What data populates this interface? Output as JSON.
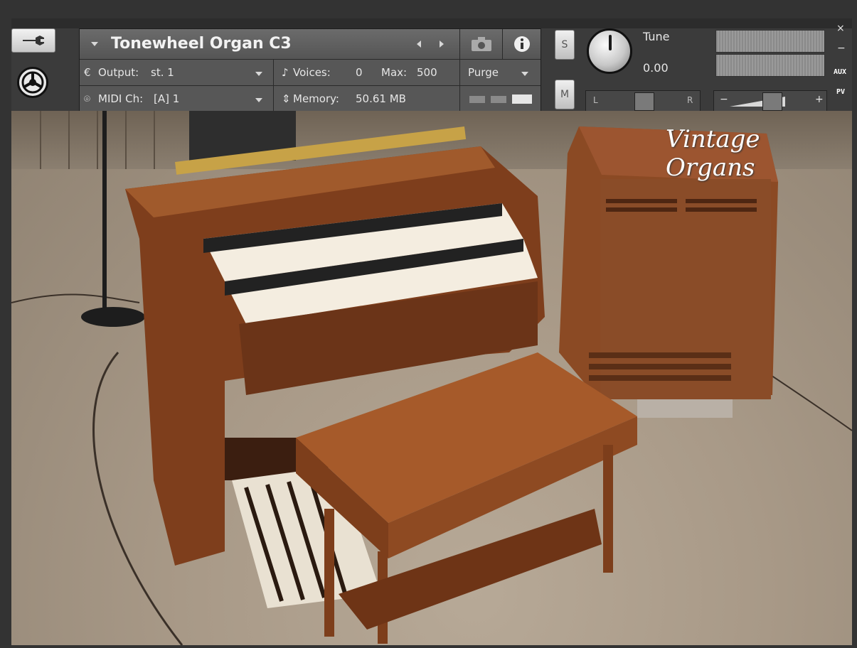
{
  "instrument": {
    "title": "Tonewheel Organ C3",
    "output_label": "Output:",
    "output_value": "st. 1",
    "voices_label": "Voices:",
    "voices_value": "0",
    "max_label": "Max:",
    "max_value": "500",
    "midi_label": "MIDI Ch:",
    "midi_value": "[A]  1",
    "memory_label": "Memory:",
    "memory_value": "50.61 MB",
    "purge_label": "Purge"
  },
  "controls": {
    "solo_label": "S",
    "mute_label": "M",
    "tune_label": "Tune",
    "tune_value": "0.00",
    "pan_left": "L",
    "pan_right": "R",
    "vol_minus": "−",
    "vol_plus": "+",
    "aux_label": "AUX",
    "pv_label": "PV",
    "close_label": "×",
    "minimize_label": "−"
  },
  "scene": {
    "brand_text": "Vintage Organs"
  },
  "icons": {
    "wrench": "wrench-icon",
    "logo": "settings-logo-icon",
    "camera": "camera-icon",
    "info": "info-icon",
    "prev": "chevron-left-icon",
    "next": "chevron-right-icon"
  }
}
